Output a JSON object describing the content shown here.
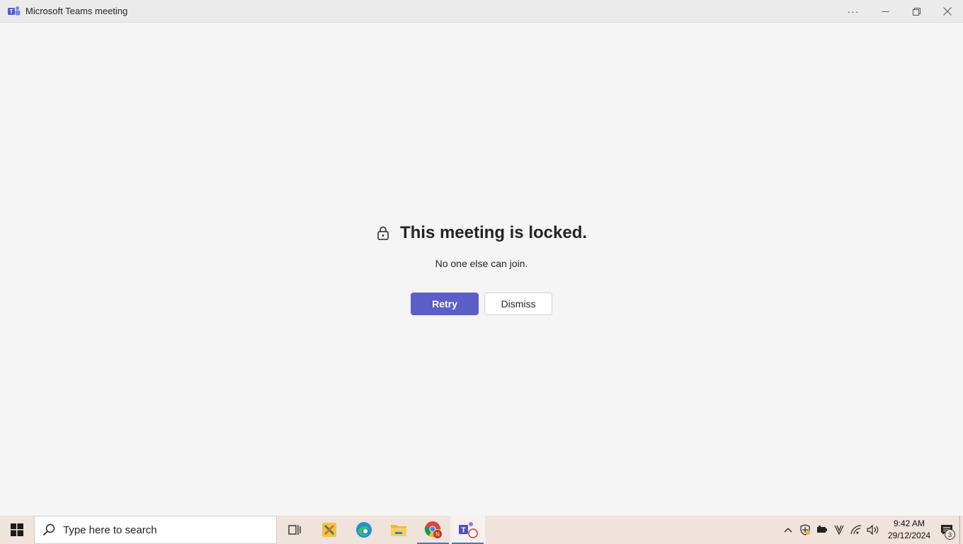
{
  "window": {
    "title": "Microsoft Teams meeting",
    "more_label": "···"
  },
  "main": {
    "headline": "This meeting is locked.",
    "subtitle": "No one else can join.",
    "retry_label": "Retry",
    "dismiss_label": "Dismiss"
  },
  "taskbar": {
    "search_placeholder": "Type here to search",
    "apps": [
      "task-view",
      "app-x",
      "edge",
      "file-explorer",
      "chrome",
      "teams"
    ],
    "time": "9:42 AM",
    "date": "29/12/2024",
    "notification_count": "3"
  },
  "colors": {
    "accent": "#5b5fc7",
    "background": "#f5f5f5",
    "taskbar": "#f0e3dc"
  }
}
